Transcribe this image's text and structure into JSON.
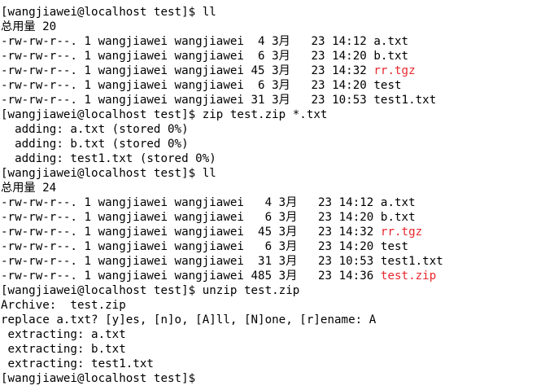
{
  "terminal": {
    "accent_colors": {
      "archive": "#e8272c",
      "text": "#000000",
      "background": "#ffffff"
    },
    "lines": [
      {
        "segments": [
          {
            "text": "[wangjiawei@localhost test]$ ll"
          }
        ]
      },
      {
        "segments": [
          {
            "text": "总用量 20"
          }
        ]
      },
      {
        "segments": [
          {
            "text": "-rw-rw-r--. 1 wangjiawei wangjiawei  4 3月   23 14:12 "
          },
          {
            "text": "a.txt"
          }
        ]
      },
      {
        "segments": [
          {
            "text": "-rw-rw-r--. 1 wangjiawei wangjiawei  6 3月   23 14:20 "
          },
          {
            "text": "b.txt"
          }
        ]
      },
      {
        "segments": [
          {
            "text": "-rw-rw-r--. 1 wangjiawei wangjiawei 45 3月   23 14:32 "
          },
          {
            "text": "rr.tgz",
            "red": true
          }
        ]
      },
      {
        "segments": [
          {
            "text": "-rw-rw-r--. 1 wangjiawei wangjiawei  6 3月   23 14:20 "
          },
          {
            "text": "test"
          }
        ]
      },
      {
        "segments": [
          {
            "text": "-rw-rw-r--. 1 wangjiawei wangjiawei 31 3月   23 10:53 "
          },
          {
            "text": "test1.txt"
          }
        ]
      },
      {
        "segments": [
          {
            "text": "[wangjiawei@localhost test]$ zip test.zip *.txt"
          }
        ]
      },
      {
        "segments": [
          {
            "text": "  adding: a.txt (stored 0%)"
          }
        ]
      },
      {
        "segments": [
          {
            "text": "  adding: b.txt (stored 0%)"
          }
        ]
      },
      {
        "segments": [
          {
            "text": "  adding: test1.txt (stored 0%)"
          }
        ]
      },
      {
        "segments": [
          {
            "text": "[wangjiawei@localhost test]$ ll"
          }
        ]
      },
      {
        "segments": [
          {
            "text": "总用量 24"
          }
        ]
      },
      {
        "segments": [
          {
            "text": "-rw-rw-r--. 1 wangjiawei wangjiawei   4 3月   23 14:12 "
          },
          {
            "text": "a.txt"
          }
        ]
      },
      {
        "segments": [
          {
            "text": "-rw-rw-r--. 1 wangjiawei wangjiawei   6 3月   23 14:20 "
          },
          {
            "text": "b.txt"
          }
        ]
      },
      {
        "segments": [
          {
            "text": "-rw-rw-r--. 1 wangjiawei wangjiawei  45 3月   23 14:32 "
          },
          {
            "text": "rr.tgz",
            "red": true
          }
        ]
      },
      {
        "segments": [
          {
            "text": "-rw-rw-r--. 1 wangjiawei wangjiawei   6 3月   23 14:20 "
          },
          {
            "text": "test"
          }
        ]
      },
      {
        "segments": [
          {
            "text": "-rw-rw-r--. 1 wangjiawei wangjiawei  31 3月   23 10:53 "
          },
          {
            "text": "test1.txt"
          }
        ]
      },
      {
        "segments": [
          {
            "text": "-rw-rw-r--. 1 wangjiawei wangjiawei 485 3月   23 14:36 "
          },
          {
            "text": "test.zip",
            "red": true
          }
        ]
      },
      {
        "segments": [
          {
            "text": "[wangjiawei@localhost test]$ unzip test.zip"
          }
        ]
      },
      {
        "segments": [
          {
            "text": "Archive:  test.zip"
          }
        ]
      },
      {
        "segments": [
          {
            "text": "replace a.txt? [y]es, [n]o, [A]ll, [N]one, [r]ename: A"
          }
        ]
      },
      {
        "segments": [
          {
            "text": " extracting: a.txt"
          }
        ]
      },
      {
        "segments": [
          {
            "text": " extracting: b.txt"
          }
        ]
      },
      {
        "segments": [
          {
            "text": " extracting: test1.txt"
          }
        ]
      },
      {
        "segments": [
          {
            "text": "[wangjiawei@localhost test]$ "
          }
        ],
        "cursor": true
      }
    ]
  }
}
